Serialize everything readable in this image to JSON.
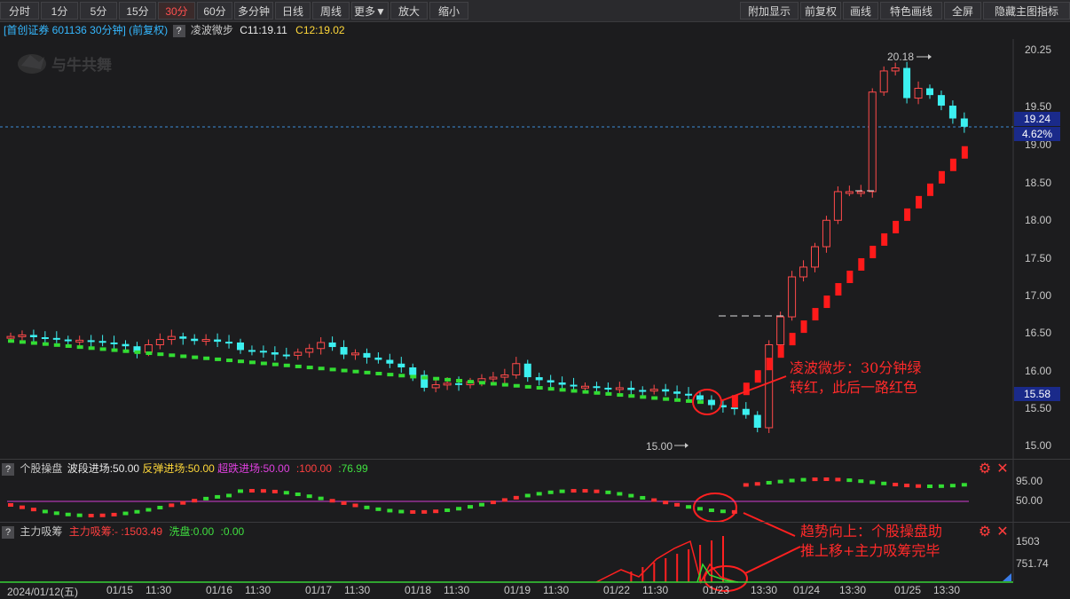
{
  "toolbar": {
    "left_buttons": [
      "分时",
      "1分",
      "5分",
      "15分",
      "30分",
      "60分",
      "多分钟",
      "日线",
      "周线",
      "更多▼",
      "放大",
      "缩小"
    ],
    "active": "30分",
    "right_buttons": [
      "附加显示",
      "前复权",
      "画线",
      "特色画线",
      "全屏",
      "隐藏主图指标"
    ]
  },
  "main_info": {
    "stock": "[首创证券 601136 30分钟] (前复权)",
    "qmark": "?",
    "indicator": "凌波微步",
    "c11": "C11:19.11",
    "c12": "C12:19.02"
  },
  "watermark": "与牛共舞",
  "price_axis": {
    "ticks": [
      "20.25",
      "19.50",
      "19.00",
      "18.50",
      "18.00",
      "17.50",
      "17.00",
      "16.50",
      "16.00",
      "15.50",
      "15.00"
    ],
    "current_price": "19.24",
    "change_pct": "4.62%",
    "marker_price": "15.58"
  },
  "annotations": {
    "high_label": "20.18",
    "low_label": "15.00",
    "callout1_line1": "凌波微步：30分钟绿",
    "callout1_line2": "转红，此后一路红色",
    "callout2_line1": "趋势向上：个股操盘助",
    "callout2_line2": "推上移+主力吸筹完毕"
  },
  "sub1": {
    "qmark": "?",
    "name": "个股操盘",
    "p1": "波段进场:50.00",
    "p2": "反弹进场:50.00",
    "p3": "超跌进场:50.00",
    "p4": ":100.00",
    "p5": ":76.99",
    "ticks": [
      "95.00",
      "50.00"
    ],
    "colors": {
      "p1": "#e8e8e8",
      "p2": "#ffd83a",
      "p3": "#e040e0",
      "p4": "#ff4040",
      "p5": "#40e040"
    }
  },
  "sub2": {
    "qmark": "?",
    "name": "主力吸筹",
    "p1": "主力吸筹:-",
    "p2": ":1503.49",
    "p3": "洗盘:0.00",
    "p4": ":0.00",
    "ticks": [
      "1503",
      "751.74"
    ]
  },
  "time_axis": [
    "2024/01/12(五)",
    "01/15",
    "11:30",
    "01/16",
    "11:30",
    "01/17",
    "11:30",
    "01/18",
    "11:30",
    "01/19",
    "11:30",
    "01/22",
    "11:30",
    "01/23",
    "13:30",
    "01/24",
    "13:30",
    "01/25",
    "13:30"
  ],
  "icons": {
    "settings": "gear-icon",
    "close": "close-icon"
  }
}
